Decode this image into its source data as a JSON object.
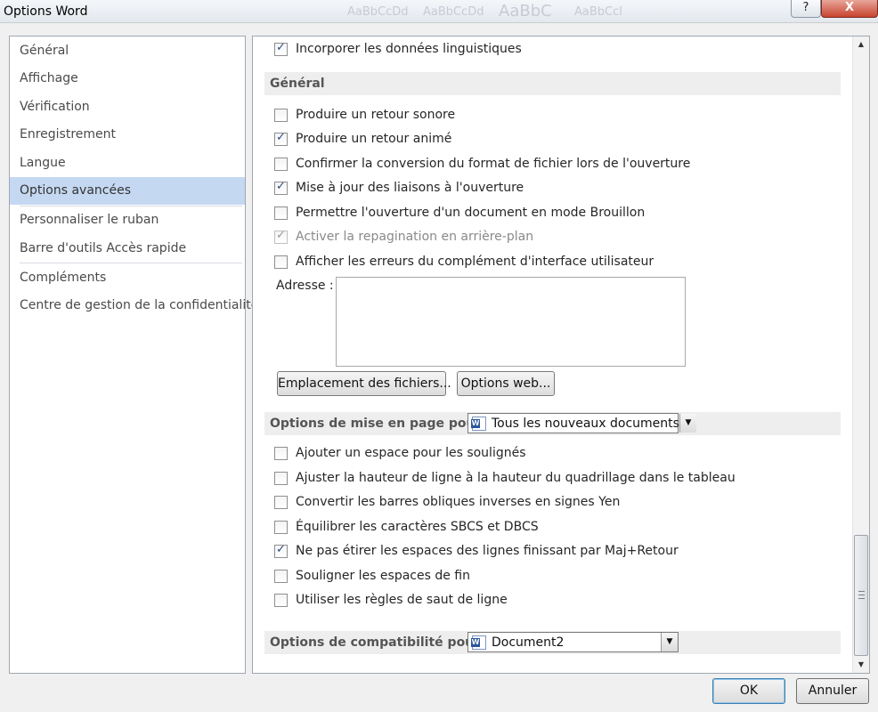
{
  "window": {
    "title": "Options Word",
    "help_label": "?",
    "close_label": "X",
    "ghost_styles": [
      "AaBbCcDd",
      "AaBbCcDd",
      "AaBbC",
      "AaBbCcI"
    ]
  },
  "nav": {
    "items": [
      {
        "label": "Général"
      },
      {
        "label": "Affichage"
      },
      {
        "label": "Vérification"
      },
      {
        "label": "Enregistrement"
      },
      {
        "label": "Langue"
      },
      {
        "label": "Options avancées",
        "selected": true
      },
      {
        "label": "Personnaliser le ruban"
      },
      {
        "label": "Barre d'outils Accès rapide"
      },
      {
        "label": "Compléments"
      },
      {
        "label": "Centre de gestion de la confidentialité"
      }
    ]
  },
  "main": {
    "top_option": {
      "label": "Incorporer les données linguistiques",
      "checked": true
    },
    "general": {
      "title": "Général",
      "options": [
        {
          "label": "Produire un retour sonore",
          "checked": false
        },
        {
          "label": "Produire un retour animé",
          "checked": true
        },
        {
          "label": "Confirmer la conversion du format de fichier lors de l'ouverture",
          "checked": false
        },
        {
          "label": "Mise à jour des liaisons à l'ouverture",
          "checked": true
        },
        {
          "label": "Permettre l'ouverture d'un document en mode Brouillon",
          "checked": false
        },
        {
          "label": "Activer la repagination en arrière-plan",
          "checked": true,
          "disabled": true
        },
        {
          "label": "Afficher les erreurs du complément d'interface utilisateur",
          "checked": false
        }
      ],
      "address_label": "Adresse :",
      "address_value": "",
      "file_locations_button": "Emplacement des fichiers...",
      "web_options_button": "Options web..."
    },
    "layout": {
      "title": "Options de mise en page pour :",
      "target": "Tous les nouveaux documents",
      "options": [
        {
          "label": "Ajouter un espace pour les soulignés",
          "checked": false
        },
        {
          "label": "Ajuster la hauteur de ligne à la hauteur du quadrillage dans le tableau",
          "checked": false
        },
        {
          "label": "Convertir les barres obliques inverses en signes Yen",
          "checked": false
        },
        {
          "label": "Équilibrer les caractères SBCS et DBCS",
          "checked": false
        },
        {
          "label": "Ne pas étirer les espaces des lignes finissant par Maj+Retour",
          "checked": true
        },
        {
          "label": "Souligner les espaces de fin",
          "checked": false
        },
        {
          "label": "Utiliser les règles de saut de ligne",
          "checked": false
        }
      ]
    },
    "compat": {
      "title": "Options de compatibilité pour :",
      "target": "Document2"
    }
  },
  "footer": {
    "ok_label": "OK",
    "cancel_label": "Annuler"
  },
  "colors": {
    "selected_nav": "#c5d8f2",
    "section_bg": "#eeeeee",
    "checkmark": "#2c4a86"
  }
}
